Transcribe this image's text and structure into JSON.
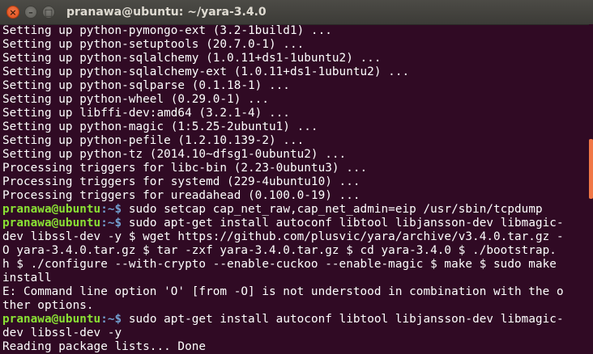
{
  "window": {
    "title": "pranawa@ubuntu: ~/yara-3.4.0",
    "buttons": {
      "close": "×",
      "minimize": "–",
      "maximize": "□"
    }
  },
  "prompt": {
    "user_host": "pranawa@ubuntu",
    "path": ":~$ "
  },
  "terminal_lines": [
    {
      "text": "Setting up python-pymongo-ext (3.2-1build1) ..."
    },
    {
      "text": "Setting up python-setuptools (20.7.0-1) ..."
    },
    {
      "text": "Setting up python-sqlalchemy (1.0.11+ds1-1ubuntu2) ..."
    },
    {
      "text": "Setting up python-sqlalchemy-ext (1.0.11+ds1-1ubuntu2) ..."
    },
    {
      "text": "Setting up python-sqlparse (0.1.18-1) ..."
    },
    {
      "text": "Setting up python-wheel (0.29.0-1) ..."
    },
    {
      "text": "Setting up libffi-dev:amd64 (3.2.1-4) ..."
    },
    {
      "text": "Setting up python-magic (1:5.25-2ubuntu1) ..."
    },
    {
      "text": "Setting up python-pefile (1.2.10.139-2) ..."
    },
    {
      "text": "Setting up python-tz (2014.10~dfsg1-0ubuntu2) ..."
    },
    {
      "text": "Processing triggers for libc-bin (2.23-0ubuntu3) ..."
    },
    {
      "text": "Processing triggers for systemd (229-4ubuntu10) ..."
    },
    {
      "text": "Processing triggers for ureadahead (0.100.0-19) ..."
    },
    {
      "prompt": true,
      "text": "sudo setcap cap_net_raw,cap_net_admin=eip /usr/sbin/tcpdump"
    },
    {
      "prompt": true,
      "text": "sudo apt-get install autoconf libtool libjansson-dev libmagic-"
    },
    {
      "text": "dev libssl-dev -y $ wget https://github.com/plusvic/yara/archive/v3.4.0.tar.gz -"
    },
    {
      "text": "O yara-3.4.0.tar.gz $ tar -zxf yara-3.4.0.tar.gz $ cd yara-3.4.0 $ ./bootstrap."
    },
    {
      "text": "h $ ./configure --with-crypto --enable-cuckoo --enable-magic $ make $ sudo make"
    },
    {
      "text": "install"
    },
    {
      "text": "E: Command line option 'O' [from -O] is not understood in combination with the o"
    },
    {
      "text": "ther options."
    },
    {
      "prompt": true,
      "text": "sudo apt-get install autoconf libtool libjansson-dev libmagic-"
    },
    {
      "text": "dev libssl-dev -y"
    },
    {
      "text": "Reading package lists... Done"
    }
  ],
  "colors": {
    "background": "#300a24",
    "foreground": "#ffffff",
    "prompt_user": "#8ae234",
    "prompt_path": "#729fcf",
    "scrollbar_thumb": "#f07746",
    "close_button": "#df4a16"
  }
}
